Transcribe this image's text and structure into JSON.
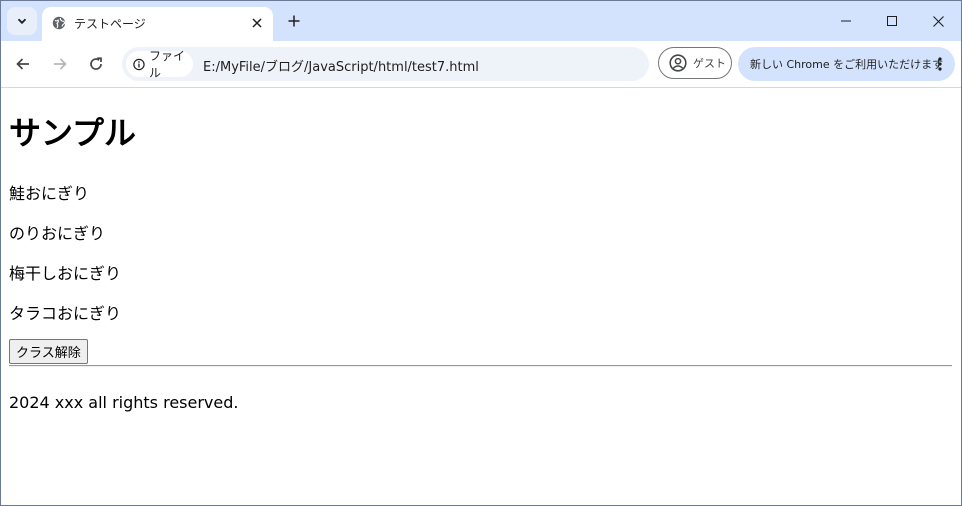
{
  "browser": {
    "tab_title": "テストページ",
    "site_info_label": "ファイル",
    "url": "E:/MyFile/ブログ/JavaScript/html/test7.html",
    "guest_label": "ゲスト",
    "update_label": "新しい Chrome をご利用いただけます"
  },
  "page": {
    "heading": "サンプル",
    "items": [
      "鮭おにぎり",
      "のりおにぎり",
      "梅干しおにぎり",
      "タラコおにぎり"
    ],
    "button_label": "クラス解除",
    "footer": "2024 xxx all rights reserved."
  }
}
